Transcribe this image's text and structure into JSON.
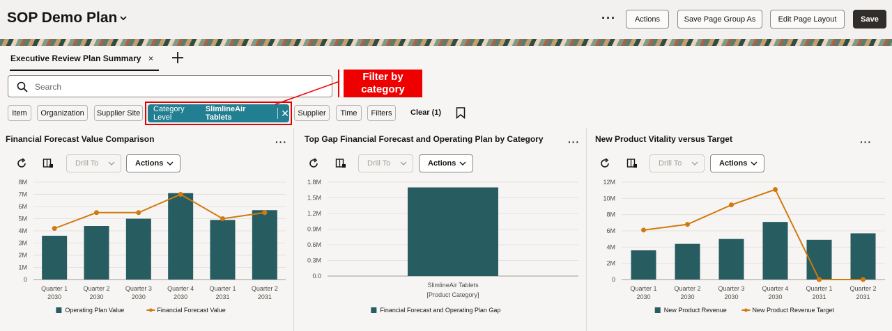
{
  "header": {
    "title": "SOP Demo Plan",
    "more_label": "···",
    "actions_label": "Actions",
    "save_group_label": "Save Page Group As",
    "edit_layout_label": "Edit Page Layout",
    "save_label": "Save"
  },
  "tabs": [
    {
      "label": "Executive Review Plan Summary",
      "close": "×"
    }
  ],
  "search": {
    "placeholder": "Search",
    "value": ""
  },
  "filters": {
    "chips": [
      "Item",
      "Organization",
      "Supplier Site",
      "Supplier",
      "Time",
      "Filters"
    ],
    "active_chip": {
      "name": "Category Level",
      "value": "SlimlineAir Tablets"
    },
    "clear_label": "Clear (1)"
  },
  "callout": {
    "text": "Filter by category"
  },
  "panel_controls": {
    "drill_label": "Drill To",
    "actions_label": "Actions",
    "kebab": "···"
  },
  "panels": [
    {
      "title": "Financial Forecast Value Comparison"
    },
    {
      "title": "Top Gap Financial Forecast and Operating Plan by Category"
    },
    {
      "title": "New Product Vitality versus Target"
    }
  ],
  "colors": {
    "bar": "#275c61",
    "line": "#d07a0f",
    "active_chip": "#227e91",
    "callout": "#ef0000"
  },
  "chart_data": [
    {
      "type": "bar",
      "categories": [
        "Quarter 1 2030",
        "Quarter 2 2030",
        "Quarter 3 2030",
        "Quarter 4 2030",
        "Quarter 1 2031",
        "Quarter 2 2031"
      ],
      "series": [
        {
          "name": "Operating Plan Value",
          "type": "bar",
          "values": [
            3.6,
            4.4,
            5.0,
            7.1,
            4.9,
            5.7
          ]
        },
        {
          "name": "Financial Forecast Value",
          "type": "line",
          "values": [
            4.2,
            5.5,
            5.5,
            7.0,
            5.0,
            5.5
          ]
        }
      ],
      "yticks": [
        "0",
        "1M",
        "2M",
        "3M",
        "4M",
        "5M",
        "6M",
        "7M",
        "8M"
      ],
      "ylim": [
        0,
        8
      ]
    },
    {
      "type": "bar",
      "categories": [
        "SlimlineAir Tablets"
      ],
      "xlabel": "[Product Category]",
      "series": [
        {
          "name": "Financial Forecast and Operating Plan Gap",
          "type": "bar",
          "values": [
            1.7
          ]
        }
      ],
      "yticks": [
        "0.0",
        "0.3M",
        "0.6M",
        "0.9M",
        "1.2M",
        "1.5M",
        "1.8M"
      ],
      "ylim": [
        0,
        1.8
      ]
    },
    {
      "type": "bar",
      "categories": [
        "Quarter 1 2030",
        "Quarter 2 2030",
        "Quarter 3 2030",
        "Quarter 4 2030",
        "Quarter 1 2031",
        "Quarter 2 2031"
      ],
      "series": [
        {
          "name": "New Product Revenue",
          "type": "bar",
          "values": [
            3.6,
            4.4,
            5.0,
            7.1,
            4.9,
            5.7
          ]
        },
        {
          "name": "New Product Revenue Target",
          "type": "line",
          "values": [
            6.1,
            6.8,
            9.2,
            11.1,
            0,
            0
          ]
        }
      ],
      "yticks": [
        "0",
        "2M",
        "4M",
        "6M",
        "8M",
        "10M",
        "12M"
      ],
      "ylim": [
        0,
        12
      ]
    }
  ]
}
